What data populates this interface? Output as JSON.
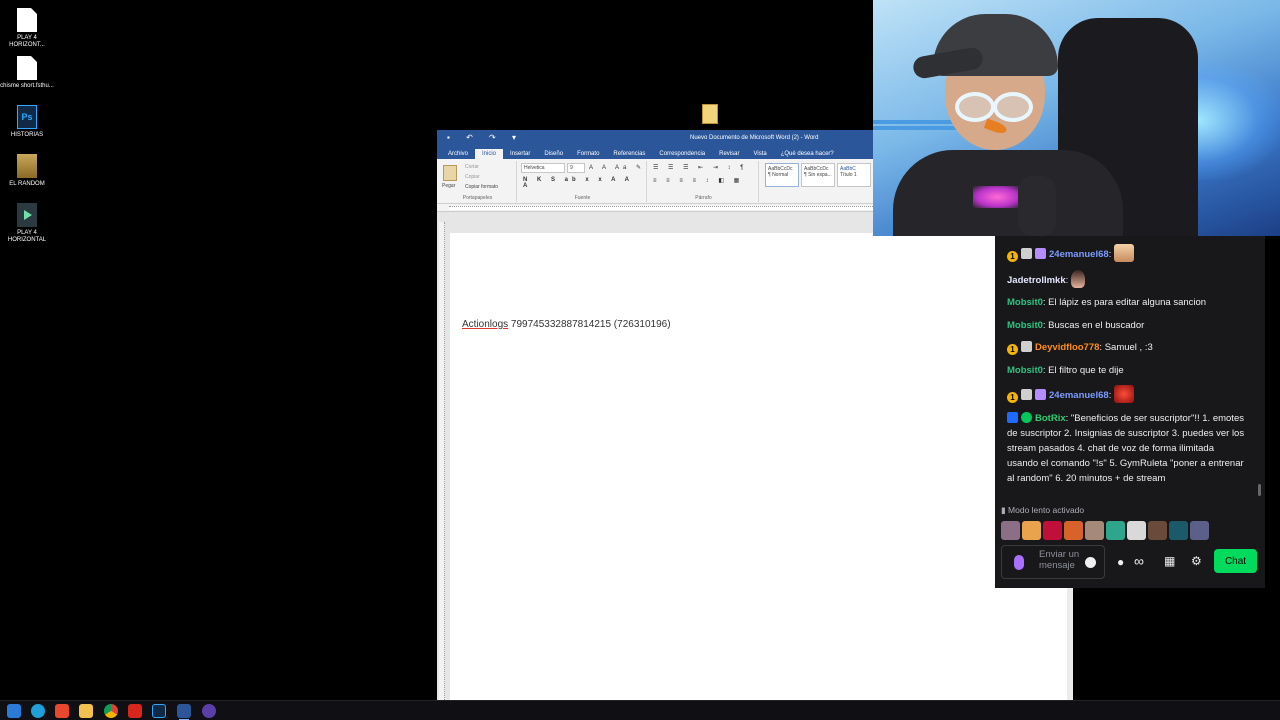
{
  "desktop": {
    "icons": [
      {
        "label": "PLAY 4 HORIZONT...",
        "icon": "file-icon"
      },
      {
        "label": "chisme short.fsthu...",
        "icon": "file-icon"
      },
      {
        "label": "HISTORIAS",
        "icon": "photoshop-icon"
      },
      {
        "label": "EL RANDOM",
        "icon": "archive-icon"
      },
      {
        "label": "PLAY 4 HORIZONTAL",
        "icon": "video-icon"
      }
    ],
    "ps_glyph": "Ps"
  },
  "word": {
    "title": "Nuevo Documento de Microsoft Word (2) - Word",
    "tabs": [
      "Archivo",
      "Inicio",
      "Insertar",
      "Diseño",
      "Formato",
      "Referencias",
      "Correspondencia",
      "Revisar",
      "Vista",
      "¿Qué desea hacer?"
    ],
    "active_tab": "Inicio",
    "clipboard": {
      "paste": "Pegar",
      "cut": "Cortar",
      "copy": "Copiar",
      "format_painter": "Copiar formato",
      "group": "Portapapeles"
    },
    "font": {
      "name": "Helvetica",
      "size": "9",
      "group": "Fuente"
    },
    "paragraph_group": "Párrafo",
    "styles": [
      {
        "preview": "AaBbCcDc",
        "name": "¶ Normal"
      },
      {
        "preview": "AaBbCcDc",
        "name": "¶ Sin espa..."
      },
      {
        "preview": "AaBbC",
        "name": "Título 1"
      }
    ],
    "document": {
      "word1": "Actionlogs",
      "rest": " 799745332887814215 (726310196)"
    }
  },
  "chat": {
    "messages": [
      {
        "user": "24emanuel68",
        "color": "#7c9cff",
        "badges": [
          "gold",
          "face",
          "gift"
        ],
        "text": "",
        "emote": "face"
      },
      {
        "user": "Jadetrollmkk",
        "color": "#e6e6ff",
        "badges": [],
        "text": "",
        "emote": "hand"
      },
      {
        "user": "Mobsit0",
        "color": "#2ec27e",
        "badges": [],
        "text": "El lápiz es para editar alguna sancion"
      },
      {
        "user": "Mobsit0",
        "color": "#2ec27e",
        "badges": [],
        "text": "Buscas en el buscador"
      },
      {
        "user": "Deyvidfloo778",
        "color": "#ff8c1a",
        "badges": [
          "gold",
          "face"
        ],
        "text": "Samuel , :3"
      },
      {
        "user": "Mobsit0",
        "color": "#2ec27e",
        "badges": [],
        "text": "El filtro que te dije"
      },
      {
        "user": "24emanuel68",
        "color": "#7c9cff",
        "badges": [
          "gold",
          "face",
          "gift"
        ],
        "text": "",
        "emote": "red"
      },
      {
        "user": "BotRix",
        "color": "#2ecc71",
        "badges": [
          "mod",
          "verif"
        ],
        "text": "\"Beneficios de ser suscriptor\"!! 1. emotes de suscriptor 2. Insignias de suscriptor 3. puedes ver los stream pasados 4. chat de voz de forma ilimitada usando el comando \"!s\" 5. GymRuleta \"poner a entrenar al random\" 6. 20 minutos + de stream"
      }
    ],
    "slow_mode": "Modo lento activado",
    "input_placeholder": "Enviar un mensaje",
    "send_label": "Chat",
    "colors": {
      "accent": "#00db5e",
      "background": "#18181b",
      "mic": "#a970ff"
    }
  },
  "taskbar": {
    "icons": [
      "start-icon",
      "edge-icon",
      "brave-icon",
      "explorer-icon",
      "chrome-icon",
      "capcut-icon",
      "photoshop-icon",
      "word-icon",
      "obs-icon"
    ],
    "active": "word-icon"
  }
}
